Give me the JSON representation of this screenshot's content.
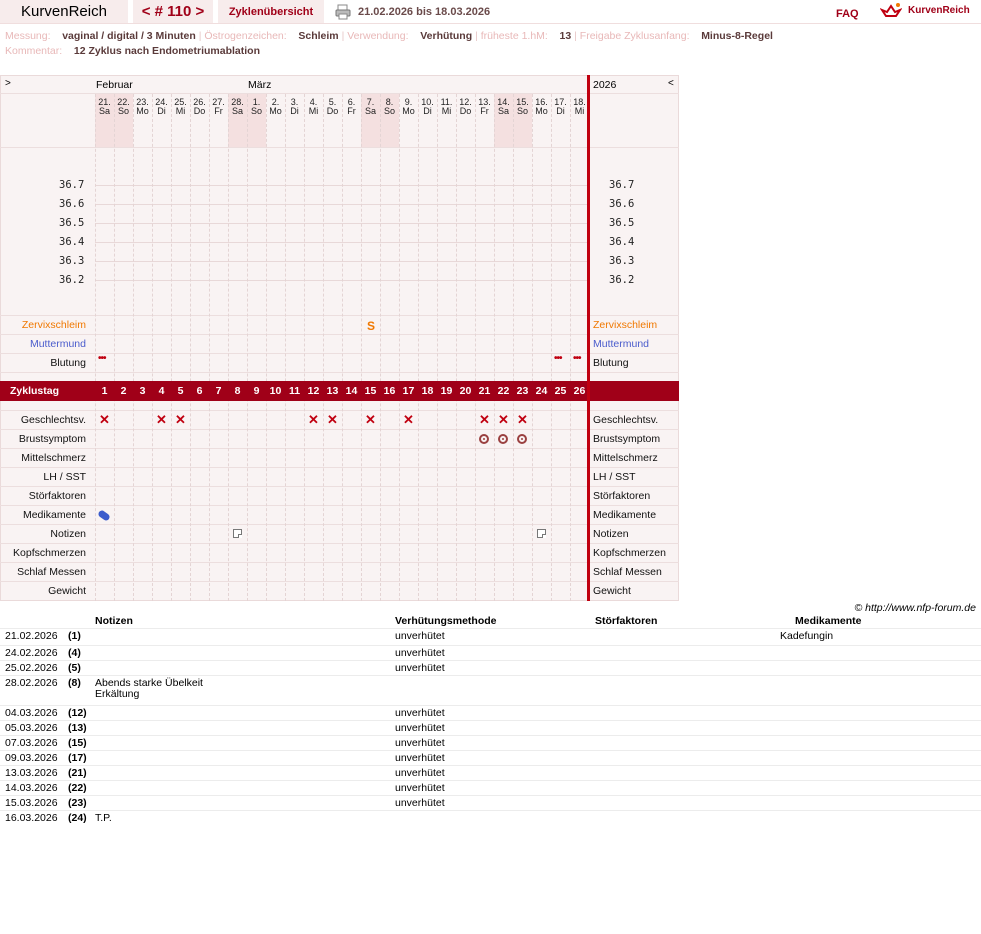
{
  "header": {
    "app_name": "KurvenReich",
    "cycle_nav": "< # 110 >",
    "overview_link": "Zyklenübersicht",
    "date_range": "21.02.2026 bis 18.03.2026",
    "faq": "FAQ",
    "brand": "KurvenReich",
    "print_icon": "printer-icon",
    "logo_icon": "crown-logo-icon"
  },
  "info": {
    "messung_label": "Messung:",
    "messung_value": "vaginal / digital / 3 Minuten",
    "oestrogen_label": "Östrogenzeichen:",
    "oestrogen_value": "Schleim",
    "verwendung_label": "Verwendung:",
    "verwendung_value": "Verhütung",
    "frueheste_label": "früheste 1.hM:",
    "frueheste_value": "13",
    "freigabe_label": "Freigabe Zyklusanfang:",
    "freigabe_value": "Minus-8-Regel",
    "kommentar_label": "Kommentar:",
    "kommentar_value": "12 Zyklus nach Endometriumablation",
    "separator": "|"
  },
  "chart": {
    "expand_left": ">",
    "expand_right": "<",
    "month_feb": "Februar",
    "month_mar": "März",
    "year": "2026",
    "dates": [
      "21.",
      "22.",
      "23.",
      "24.",
      "25.",
      "26.",
      "27.",
      "28.",
      "1.",
      "2.",
      "3.",
      "4.",
      "5.",
      "6.",
      "7.",
      "8.",
      "9.",
      "10.",
      "11.",
      "12.",
      "13.",
      "14.",
      "15.",
      "16.",
      "17.",
      "18."
    ],
    "weekdays": [
      "Sa",
      "So",
      "Mo",
      "Di",
      "Mi",
      "Do",
      "Fr",
      "Sa",
      "So",
      "Mo",
      "Di",
      "Mi",
      "Do",
      "Fr",
      "Sa",
      "So",
      "Mo",
      "Di",
      "Mi",
      "Do",
      "Fr",
      "Sa",
      "So",
      "Mo",
      "Di",
      "Mi"
    ],
    "weekend_indices": [
      0,
      1,
      7,
      8,
      14,
      15,
      21,
      22
    ],
    "temps": [
      "36.7",
      "36.6",
      "36.5",
      "36.4",
      "36.3",
      "36.2"
    ],
    "zyklustag_label": "Zyklustag",
    "cycle_days": [
      "1",
      "2",
      "3",
      "4",
      "5",
      "6",
      "7",
      "8",
      "9",
      "10",
      "11",
      "12",
      "13",
      "14",
      "15",
      "16",
      "17",
      "18",
      "19",
      "20",
      "21",
      "22",
      "23",
      "24",
      "25",
      "26"
    ],
    "rows": {
      "zervix": "Zervixschleim",
      "muttermund": "Muttermund",
      "blutung": "Blutung",
      "geschlechtsv": "Geschlechtsv.",
      "brust": "Brustsymptom",
      "mittel": "Mittelschmerz",
      "lh": "LH / SST",
      "stoer": "Störfaktoren",
      "medi": "Medikamente",
      "notizen": "Notizen",
      "kopf": "Kopfschmerzen",
      "schlaf": "Schlaf Messen",
      "gewicht": "Gewicht"
    },
    "zervix_mark": "S",
    "zervix_mark_day_index": 14,
    "blutung_day_indices": [
      0,
      24,
      25
    ],
    "geschlechtsv_day_indices": [
      0,
      3,
      4,
      11,
      12,
      14,
      16,
      20,
      21,
      22
    ],
    "brust_day_indices": [
      20,
      21,
      22
    ],
    "medikamente_day_indices": [
      0
    ],
    "notizen_day_indices": [
      7,
      23
    ]
  },
  "copyright": "© http://www.nfp-forum.de",
  "table": {
    "headers": {
      "notizen": "Notizen",
      "verhuetung": "Verhütungsmethode",
      "stoer": "Störfaktoren",
      "medi": "Medikamente"
    },
    "rows": [
      {
        "date": "21.02.2026",
        "day": "(1)",
        "note": "",
        "method": "unverhütet",
        "medi": "Kadefungin"
      },
      {
        "date": "24.02.2026",
        "day": "(4)",
        "note": "",
        "method": "unverhütet",
        "medi": ""
      },
      {
        "date": "25.02.2026",
        "day": "(5)",
        "note": "",
        "method": "unverhütet",
        "medi": ""
      },
      {
        "date": "28.02.2026",
        "day": "(8)",
        "note": "Abends starke Übelkeit",
        "note2": "Erkältung",
        "method": "",
        "medi": ""
      },
      {
        "date": "04.03.2026",
        "day": "(12)",
        "note": "",
        "method": "unverhütet",
        "medi": ""
      },
      {
        "date": "05.03.2026",
        "day": "(13)",
        "note": "",
        "method": "unverhütet",
        "medi": ""
      },
      {
        "date": "07.03.2026",
        "day": "(15)",
        "note": "",
        "method": "unverhütet",
        "medi": ""
      },
      {
        "date": "09.03.2026",
        "day": "(17)",
        "note": "",
        "method": "unverhütet",
        "medi": ""
      },
      {
        "date": "13.03.2026",
        "day": "(21)",
        "note": "",
        "method": "unverhütet",
        "medi": ""
      },
      {
        "date": "14.03.2026",
        "day": "(22)",
        "note": "",
        "method": "unverhütet",
        "medi": ""
      },
      {
        "date": "15.03.2026",
        "day": "(23)",
        "note": "",
        "method": "unverhütet",
        "medi": ""
      },
      {
        "date": "16.03.2026",
        "day": "(24)",
        "note": "T.P.",
        "method": "",
        "medi": ""
      }
    ]
  },
  "colors": {
    "accent": "#a00018",
    "zervix": "#f07800",
    "muttermund": "#4a5ccc",
    "redline": "#c00010"
  }
}
